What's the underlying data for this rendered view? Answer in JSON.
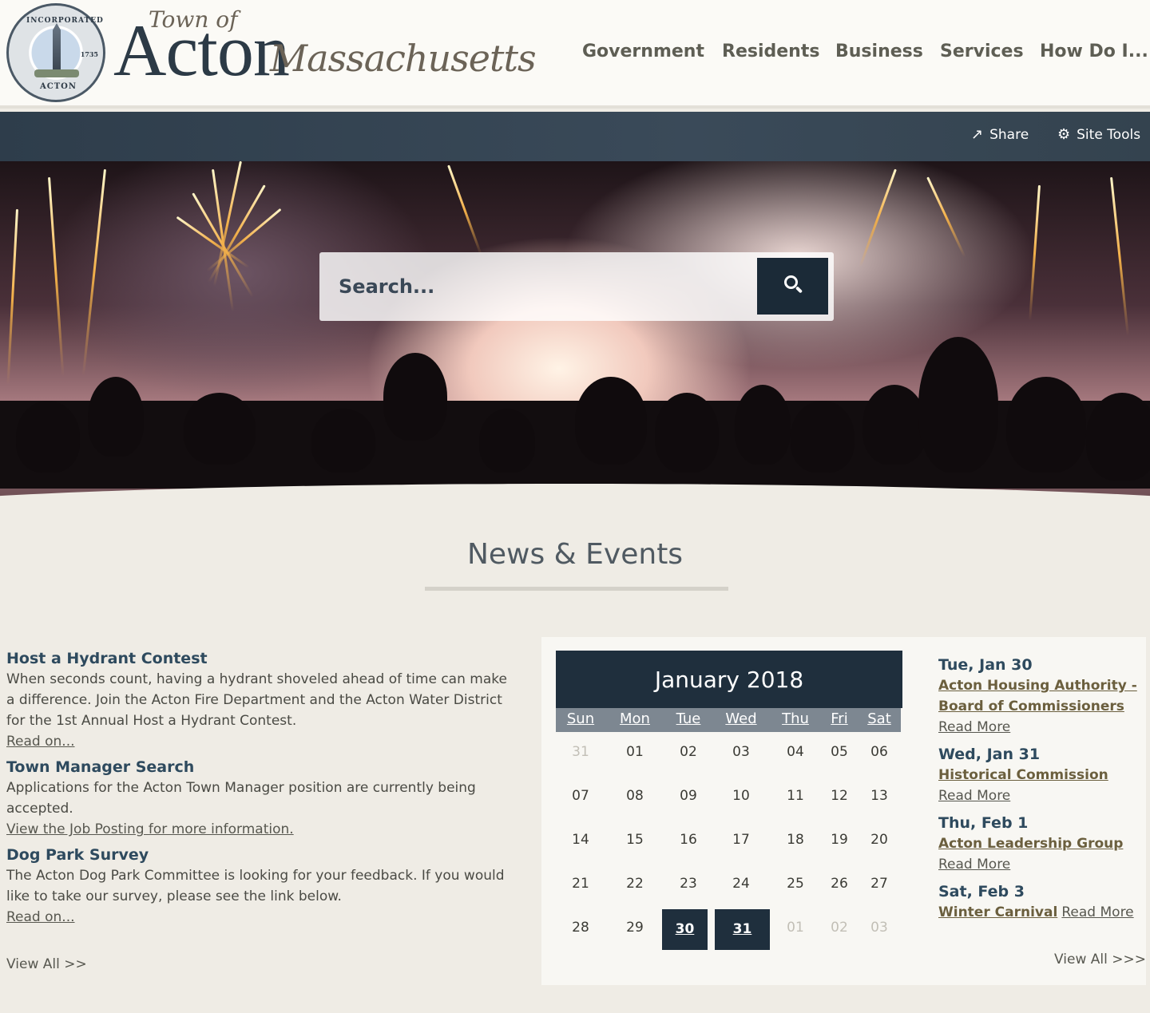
{
  "header": {
    "seal": {
      "top_text": "INCORPORATED",
      "year": "1735",
      "bottom_text": "ACTON"
    },
    "logo": {
      "town_of": "Town of",
      "acton": "Acton",
      "state": "Massachusetts"
    },
    "nav": [
      "Government",
      "Residents",
      "Business",
      "Services",
      "How Do I..."
    ]
  },
  "toolbar": {
    "share_label": "Share",
    "site_tools_label": "Site Tools"
  },
  "search": {
    "placeholder": "Search..."
  },
  "section": {
    "title": "News & Events"
  },
  "news": {
    "items": [
      {
        "title": "Host a Hydrant Contest",
        "body": "When seconds count, having a hydrant shoveled ahead of time can make a difference. Join the Acton Fire Department and the Acton Water District for the 1st Annual Host a Hydrant Contest.",
        "link": "Read on..."
      },
      {
        "title": "Town Manager Search",
        "body": "Applications for the Acton Town Manager position are currently being accepted.",
        "link": "View the Job Posting for more information."
      },
      {
        "title": "Dog Park Survey",
        "body": "The Acton Dog Park Committee is looking for your feedback. If you would like to take our survey, please see the link below.",
        "link": "Read on..."
      }
    ],
    "view_all": "View All >>"
  },
  "calendar": {
    "month_label": "January 2018",
    "days_of_week": [
      "Sun",
      "Mon",
      "Tue",
      "Wed",
      "Thu",
      "Fri",
      "Sat"
    ],
    "weeks": [
      [
        "31",
        "01",
        "02",
        "03",
        "04",
        "05",
        "06"
      ],
      [
        "07",
        "08",
        "09",
        "10",
        "11",
        "12",
        "13"
      ],
      [
        "14",
        "15",
        "16",
        "17",
        "18",
        "19",
        "20"
      ],
      [
        "21",
        "22",
        "23",
        "24",
        "25",
        "26",
        "27"
      ],
      [
        "28",
        "29",
        "30",
        "31",
        "01",
        "02",
        "03"
      ]
    ],
    "outside_month": [
      "0-0",
      "4-4",
      "4-5",
      "4-6"
    ],
    "highlighted": [
      "4-2",
      "4-3"
    ]
  },
  "events": {
    "items": [
      {
        "date": "Tue, Jan 30",
        "title": "Acton Housing Authority - Board of Commissioners",
        "more": "Read More"
      },
      {
        "date": "Wed, Jan 31",
        "title": "Historical Commission",
        "more": "Read More"
      },
      {
        "date": "Thu, Feb 1",
        "title": "Acton Leadership Group",
        "more": "Read More"
      },
      {
        "date": "Sat, Feb 3",
        "title": "Winter Carnival",
        "more": "Read More"
      }
    ],
    "view_all": "View All >>>"
  },
  "colors": {
    "navy": "#1f2f3d",
    "title_blue": "#2e4a5e",
    "event_gold": "#6b5f3e",
    "background": "#efece5"
  }
}
